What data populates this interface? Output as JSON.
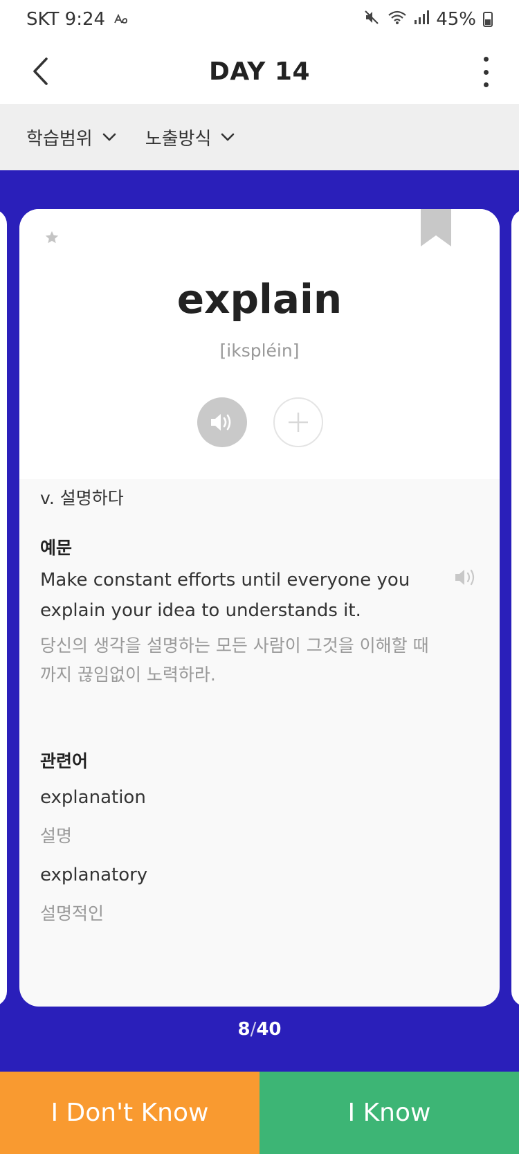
{
  "status_bar": {
    "carrier_time": "SKT 9:24",
    "battery": "45%",
    "icons": [
      "signal-a-icon",
      "mute-icon",
      "wifi-icon",
      "cell-signal-icon",
      "battery-icon"
    ]
  },
  "header": {
    "title": "DAY 14"
  },
  "filters": {
    "range_label": "학습범위",
    "display_label": "노출방식"
  },
  "card": {
    "word": "explain",
    "pronunciation": "[ikspléin]",
    "meaning": "v. 설명하다",
    "example_heading": "예문",
    "example_en": "Make constant efforts until everyone you explain your idea to understands it.",
    "example_ko": "당신의 생각을 설명하는 모든 사람이 그것을 이해할 때까지 끊임없이 노력하라.",
    "related_heading": "관련어",
    "related": [
      {
        "word": "explanation",
        "meaning": "설명"
      },
      {
        "word": "explanatory",
        "meaning": "설명적인"
      }
    ]
  },
  "progress": {
    "current": "8",
    "separator": "/",
    "total": "40"
  },
  "buttons": {
    "dont_know": "I Don't Know",
    "know": "I Know"
  },
  "colors": {
    "primary_blue": "#2a1fba",
    "dont_know_orange": "#f99a30",
    "know_green": "#3db575"
  }
}
